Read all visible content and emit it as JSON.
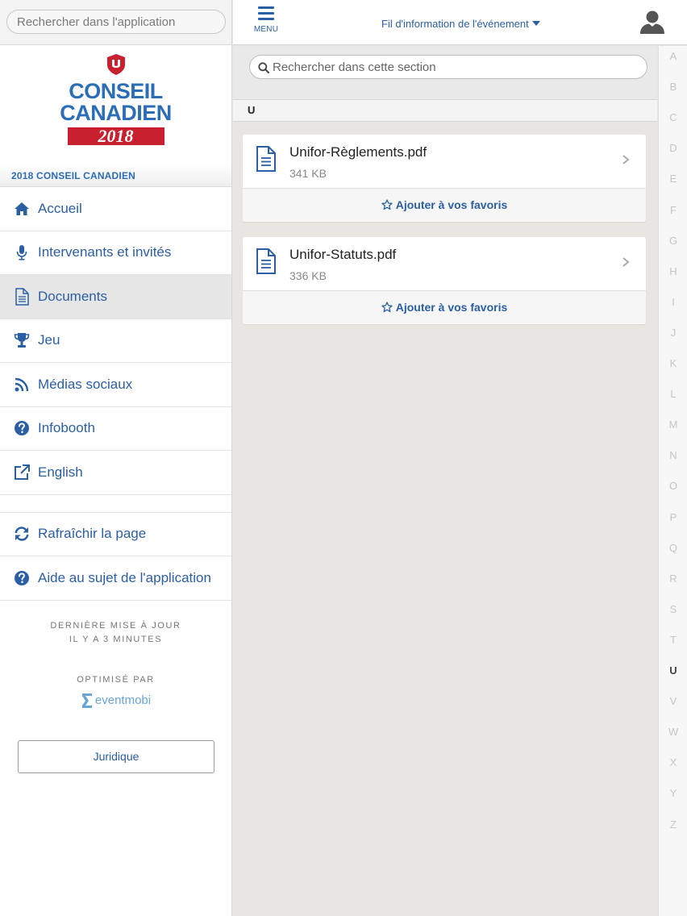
{
  "sidebar": {
    "search_placeholder": "Rechercher dans l'application",
    "logo": {
      "line1": "CONSEIL",
      "line2": "CANADIEN",
      "year": "2018"
    },
    "section_title": "2018 CONSEIL CANADIEN",
    "items": [
      {
        "label": "Accueil",
        "icon": "home-icon"
      },
      {
        "label": "Intervenants et invités",
        "icon": "microphone-icon"
      },
      {
        "label": "Documents",
        "icon": "document-icon"
      },
      {
        "label": "Jeu",
        "icon": "trophy-icon"
      },
      {
        "label": "Médias sociaux",
        "icon": "rss-icon"
      },
      {
        "label": "Infobooth",
        "icon": "question-circle-icon"
      },
      {
        "label": "English",
        "icon": "external-link-icon"
      }
    ],
    "items_secondary": [
      {
        "label": "Rafraîchir la page",
        "icon": "refresh-icon"
      },
      {
        "label": "Aide au sujet de l'application",
        "icon": "question-circle-icon"
      }
    ],
    "updated_line1": "DERNIÈRE MISE À JOUR",
    "updated_line2": "IL Y A 3 MINUTES",
    "powered_by": "OPTIMISÉ PAR",
    "brand_name": "eventmobi",
    "legal_label": "Juridique"
  },
  "topbar": {
    "menu_label": "MENU",
    "feed_label": "Fil d'information de l'événement"
  },
  "content": {
    "search_placeholder": "Rechercher dans cette section",
    "section_letter": "U",
    "documents": [
      {
        "title": "Unifor-Règlements.pdf",
        "size": "341 KB",
        "fav_label": "Ajouter à vos favoris"
      },
      {
        "title": "Unifor-Statuts.pdf",
        "size": "336 KB",
        "fav_label": "Ajouter à vos favoris"
      }
    ]
  },
  "alphabet": {
    "letters": [
      "A",
      "B",
      "C",
      "D",
      "E",
      "F",
      "G",
      "H",
      "I",
      "J",
      "K",
      "L",
      "M",
      "N",
      "O",
      "P",
      "Q",
      "R",
      "S",
      "T",
      "U",
      "V",
      "W",
      "X",
      "Y",
      "Z"
    ],
    "active": "U"
  },
  "colors": {
    "accent": "#2b5fa3",
    "logo_blue": "#2b6db6",
    "logo_red": "#c8202f",
    "background": "#e8e6e1"
  }
}
